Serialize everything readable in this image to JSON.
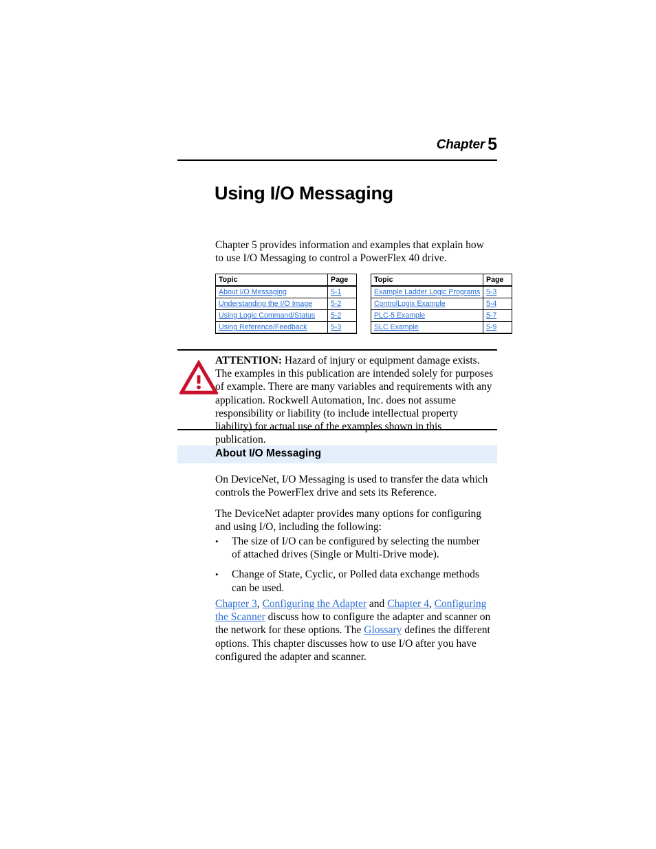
{
  "header": {
    "chapter_word": "Chapter",
    "chapter_number": "5"
  },
  "title": "Using I/O Messaging",
  "intro": "Chapter 5 provides information and examples that explain how to use I/O Messaging to control a PowerFlex 40 drive.",
  "topic_tables": [
    {
      "headers": [
        "Topic",
        "Page"
      ],
      "rows": [
        {
          "topic": "About I/O Messaging",
          "page": "5-1"
        },
        {
          "topic": "Understanding the I/O Image",
          "page": "5-2"
        },
        {
          "topic": "Using Logic Command/Status",
          "page": "5-2"
        },
        {
          "topic": "Using Reference/Feedback",
          "page": "5-3"
        }
      ]
    },
    {
      "headers": [
        "Topic",
        "Page"
      ],
      "rows": [
        {
          "topic": "Example Ladder Logic Programs",
          "page": "5-3"
        },
        {
          "topic": "ControlLogix Example",
          "page": "5-4"
        },
        {
          "topic": "PLC-5 Example",
          "page": "5-7"
        },
        {
          "topic": "SLC Example",
          "page": "5-9"
        }
      ]
    }
  ],
  "attention": {
    "label": "ATTENTION:",
    "text": " Hazard of injury or equipment damage exists. The examples in this publication are intended solely for purposes of example. There are many variables and requirements with any application. Rockwell Automation, Inc. does not assume responsibility or liability (to include intellectual property liability) for actual use of the examples shown in this publication.",
    "icon": "warning-triangle-icon",
    "icon_color": "#C8102E"
  },
  "section": {
    "heading": "About I/O Messaging",
    "band_color": "#e4eefb",
    "paragraph_1": "On DeviceNet, I/O Messaging is used to transfer the data which controls the PowerFlex drive and sets its Reference.",
    "paragraph_2": "The DeviceNet adapter provides many options for configuring and using I/O, including the following:",
    "bullets": [
      "The size of I/O can be configured by selecting the number of attached drives (Single or Multi-Drive mode).",
      "Change of State, Cyclic, or Polled data exchange methods can be used."
    ],
    "paragraph_4": {
      "link_1": "Chapter 3",
      "sep_1": ", ",
      "link_2": "Configuring the Adapter",
      "sep_2": " and ",
      "link_3": "Chapter 4",
      "sep_3": ", ",
      "link_4": "Configuring the Scanner",
      "text_1": " discuss how to configure the adapter and scanner on the network for these options. The ",
      "link_5": "Glossary",
      "text_2": " defines the different options. This chapter discusses how to use I/O after you have configured the adapter and scanner."
    }
  },
  "link_color": "#2a6fd4"
}
